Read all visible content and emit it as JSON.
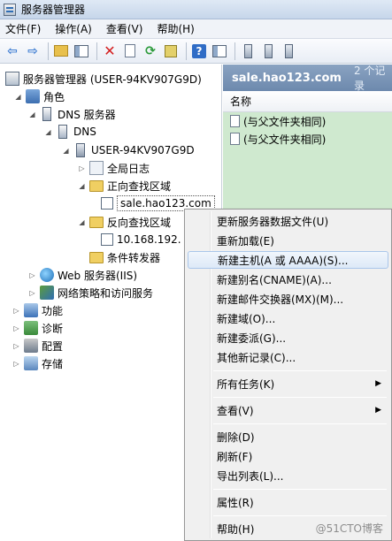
{
  "window": {
    "title": "服务器管理器"
  },
  "menu": [
    "文件(F)",
    "操作(A)",
    "查看(V)",
    "帮助(H)"
  ],
  "tree": {
    "root": "服务器管理器 (USER-94KV907G9D)",
    "roles": "角色",
    "dns_server": "DNS 服务器",
    "dns": "DNS",
    "host": "USER-94KV907G9D",
    "global_log": "全局日志",
    "forward_zone": "正向查找区域",
    "selected_zone": "sale.hao123.com",
    "reverse_zone": "反向查找区域",
    "reverse_item": "10.168.192.",
    "conditional_fwd": "条件转发器",
    "web_server": "Web 服务器(IIS)",
    "network_policy": "网络策略和访问服务",
    "features": "功能",
    "diagnostics": "诊断",
    "configuration": "配置",
    "storage": "存储"
  },
  "right": {
    "zone_title": "sale.hao123.com",
    "record_count": "2 个记录",
    "column_name": "名称",
    "rows": [
      "(与父文件夹相同)",
      "(与父文件夹相同)"
    ]
  },
  "context_menu": {
    "update_server_data": "更新服务器数据文件(U)",
    "reload": "重新加载(E)",
    "new_host": "新建主机(A 或 AAAA)(S)...",
    "new_alias": "新建别名(CNAME)(A)...",
    "new_mail_exchanger": "新建邮件交换器(MX)(M)...",
    "new_domain": "新建域(O)...",
    "new_delegation": "新建委派(G)...",
    "other_new_records": "其他新记录(C)...",
    "all_tasks": "所有任务(K)",
    "view": "查看(V)",
    "delete": "删除(D)",
    "refresh": "刷新(F)",
    "export_list": "导出列表(L)...",
    "properties": "属性(R)",
    "help": "帮助(H)"
  },
  "watermark": "@51CTO博客"
}
